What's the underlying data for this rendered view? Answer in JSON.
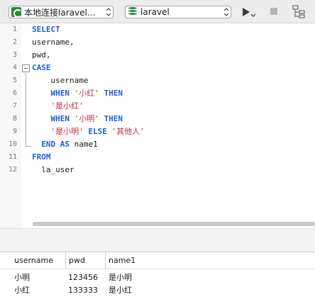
{
  "toolbar": {
    "connection_label": "本地连接laravel…",
    "database_label": "laravel",
    "run_icon": "run-icon",
    "stop_icon": "stop-icon",
    "explain_icon": "explain-icon"
  },
  "editor": {
    "lines": [
      {
        "num": "1",
        "parts": [
          {
            "t": "SELECT",
            "c": "kw"
          }
        ]
      },
      {
        "num": "2",
        "parts": [
          {
            "t": "username,",
            "c": ""
          }
        ]
      },
      {
        "num": "3",
        "parts": [
          {
            "t": "pwd,",
            "c": ""
          }
        ]
      },
      {
        "num": "4",
        "parts": [
          {
            "t": "CASE",
            "c": "kw"
          }
        ]
      },
      {
        "num": "5",
        "parts": [
          {
            "t": "    username",
            "c": ""
          }
        ]
      },
      {
        "num": "6",
        "parts": [
          {
            "t": "    ",
            "c": ""
          },
          {
            "t": "WHEN",
            "c": "kw"
          },
          {
            "t": " ",
            "c": ""
          },
          {
            "t": "'小红'",
            "c": "str"
          },
          {
            "t": " ",
            "c": ""
          },
          {
            "t": "THEN",
            "c": "kw"
          }
        ]
      },
      {
        "num": "7",
        "parts": [
          {
            "t": "    ",
            "c": ""
          },
          {
            "t": "'是小红'",
            "c": "str"
          }
        ]
      },
      {
        "num": "8",
        "parts": [
          {
            "t": "    ",
            "c": ""
          },
          {
            "t": "WHEN",
            "c": "kw"
          },
          {
            "t": " ",
            "c": ""
          },
          {
            "t": "'小明'",
            "c": "str"
          },
          {
            "t": " ",
            "c": ""
          },
          {
            "t": "THEN",
            "c": "kw"
          }
        ]
      },
      {
        "num": "9",
        "parts": [
          {
            "t": "    ",
            "c": ""
          },
          {
            "t": "'是小明'",
            "c": "str"
          },
          {
            "t": " ",
            "c": ""
          },
          {
            "t": "ELSE",
            "c": "kw"
          },
          {
            "t": " ",
            "c": ""
          },
          {
            "t": "'其他人'",
            "c": "str"
          }
        ]
      },
      {
        "num": "10",
        "parts": [
          {
            "t": "  ",
            "c": ""
          },
          {
            "t": "END",
            "c": "kw"
          },
          {
            "t": " ",
            "c": ""
          },
          {
            "t": "AS",
            "c": "kw"
          },
          {
            "t": " name1",
            "c": ""
          }
        ]
      },
      {
        "num": "11",
        "parts": [
          {
            "t": "FROM",
            "c": "kw"
          }
        ]
      },
      {
        "num": "12",
        "parts": [
          {
            "t": "  la_user",
            "c": ""
          }
        ]
      }
    ]
  },
  "results": {
    "columns": [
      "username",
      "pwd",
      "name1"
    ],
    "rows": [
      [
        "小明",
        "123456",
        "是小明"
      ],
      [
        "小红",
        "133333",
        "是小红"
      ]
    ]
  }
}
